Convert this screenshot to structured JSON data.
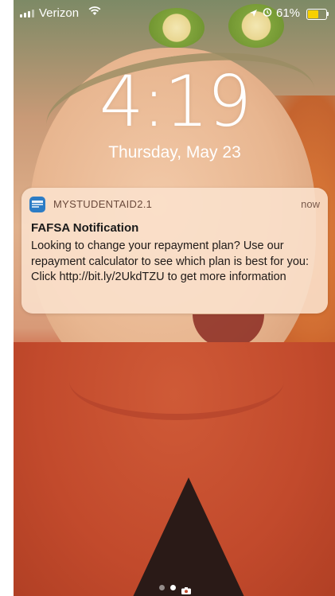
{
  "status_bar": {
    "carrier": "Verizon",
    "battery_percent": "61%",
    "battery_level": 0.61,
    "battery_color": "#f7d000",
    "icons": [
      "signal-icon",
      "wifi-icon",
      "location-icon",
      "alarm-icon",
      "battery-icon"
    ]
  },
  "lock_screen": {
    "time": "4:19",
    "date": "Thursday, May 23"
  },
  "notification": {
    "app_name": "MYSTUDENTAID2.1",
    "time": "now",
    "title": "FAFSA Notification",
    "body": "Looking to change your repayment plan? Use our repayment calculator to see which plan is best for you: Click http://bit.ly/2UkdTZU to get more information",
    "app_icon_color": "#2c7cc5"
  },
  "page_indicator": {
    "pages": 2,
    "active_index": 1,
    "trailing_icon": "camera-icon"
  }
}
